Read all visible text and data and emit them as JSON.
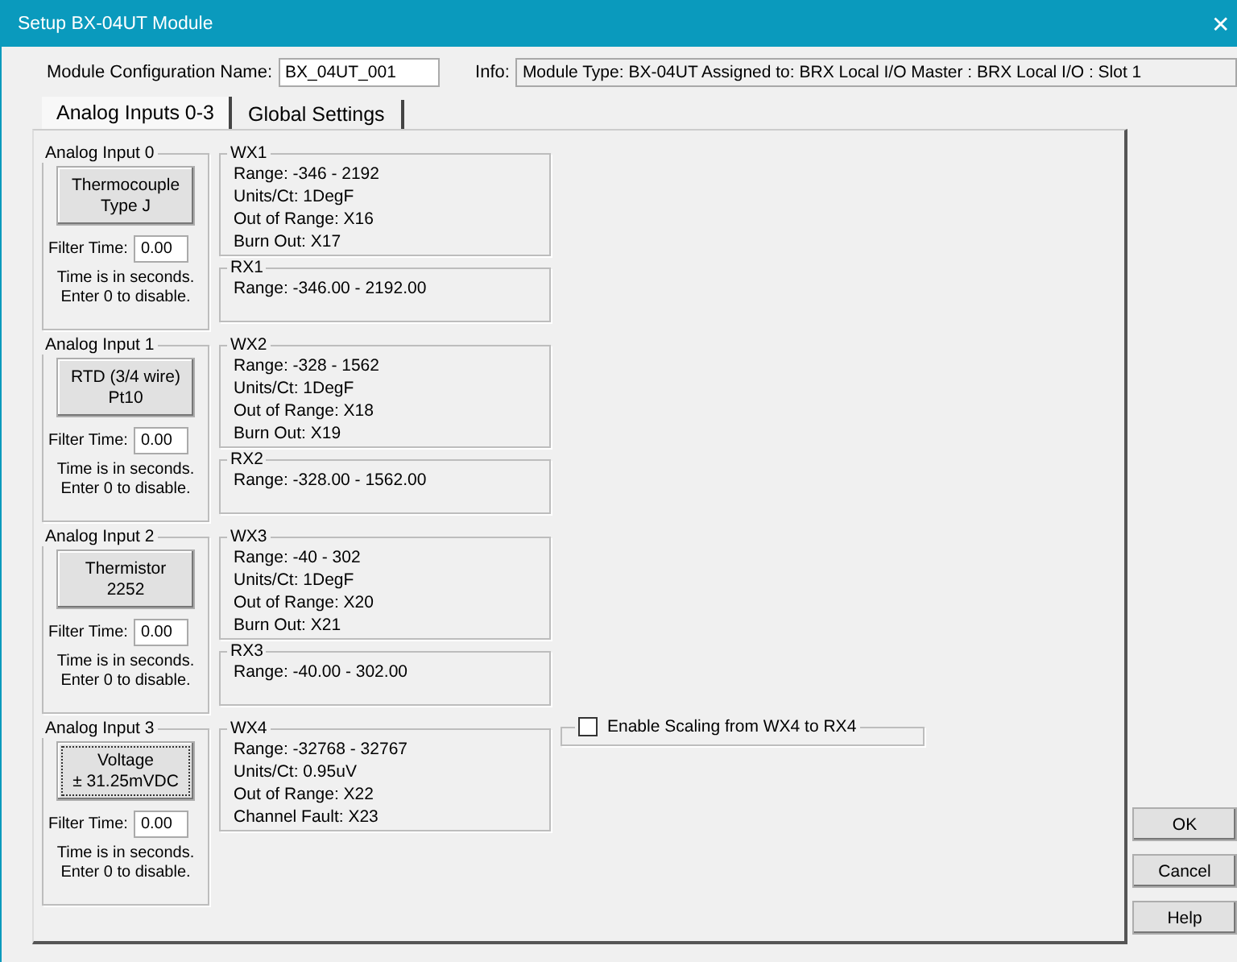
{
  "window": {
    "title": "Setup BX-04UT Module",
    "close": "✕"
  },
  "config_name": {
    "label": "Module Configuration Name:",
    "value": "BX_04UT_001"
  },
  "info": {
    "label": "Info:",
    "value": "Module Type: BX-04UT   Assigned to: BRX Local I/O Master : BRX Local I/O : Slot 1"
  },
  "tabs": [
    {
      "label": "Analog Inputs 0-3",
      "selected": true
    },
    {
      "label": "Global Settings",
      "selected": false
    }
  ],
  "channels": [
    {
      "title": "Analog Input 0",
      "type": "Thermocouple\nType J",
      "focused": false,
      "filter_label": "Filter Time:",
      "filter_value": "0.00",
      "note": "Time is in seconds.\nEnter 0 to disable.",
      "wx": {
        "title": "WX1",
        "lines": [
          "Range: -346 - 2192",
          "Units/Ct: 1DegF",
          "Out of Range: X16",
          "Burn Out: X17"
        ]
      },
      "rx": {
        "title": "RX1",
        "lines": [
          "Range: -346.00 - 2192.00"
        ]
      }
    },
    {
      "title": "Analog Input 1",
      "type": "RTD (3/4 wire)\nPt10",
      "focused": false,
      "filter_label": "Filter Time:",
      "filter_value": "0.00",
      "note": "Time is in seconds.\nEnter 0 to disable.",
      "wx": {
        "title": "WX2",
        "lines": [
          "Range: -328 - 1562",
          "Units/Ct: 1DegF",
          "Out of Range: X18",
          "Burn Out: X19"
        ]
      },
      "rx": {
        "title": "RX2",
        "lines": [
          "Range: -328.00 - 1562.00"
        ]
      }
    },
    {
      "title": "Analog Input 2",
      "type": "Thermistor\n2252",
      "focused": false,
      "filter_label": "Filter Time:",
      "filter_value": "0.00",
      "note": "Time is in seconds.\nEnter 0 to disable.",
      "wx": {
        "title": "WX3",
        "lines": [
          "Range: -40 - 302",
          "Units/Ct: 1DegF",
          "Out of Range: X20",
          "Burn Out: X21"
        ]
      },
      "rx": {
        "title": "RX3",
        "lines": [
          "Range: -40.00 - 302.00"
        ]
      }
    },
    {
      "title": "Analog Input 3",
      "type": "Voltage\n± 31.25mVDC",
      "focused": true,
      "filter_label": "Filter Time:",
      "filter_value": "0.00",
      "note": "Time is in seconds.\nEnter 0 to disable.",
      "wx": {
        "title": "WX4",
        "lines": [
          "Range: -32768 - 32767",
          "Units/Ct: 0.95uV",
          "Out of Range: X22",
          "Channel Fault: X23"
        ]
      },
      "scaling": {
        "label": "Enable Scaling from WX4 to RX4",
        "checked": false
      }
    }
  ],
  "buttons": [
    "OK",
    "Cancel",
    "Help"
  ]
}
